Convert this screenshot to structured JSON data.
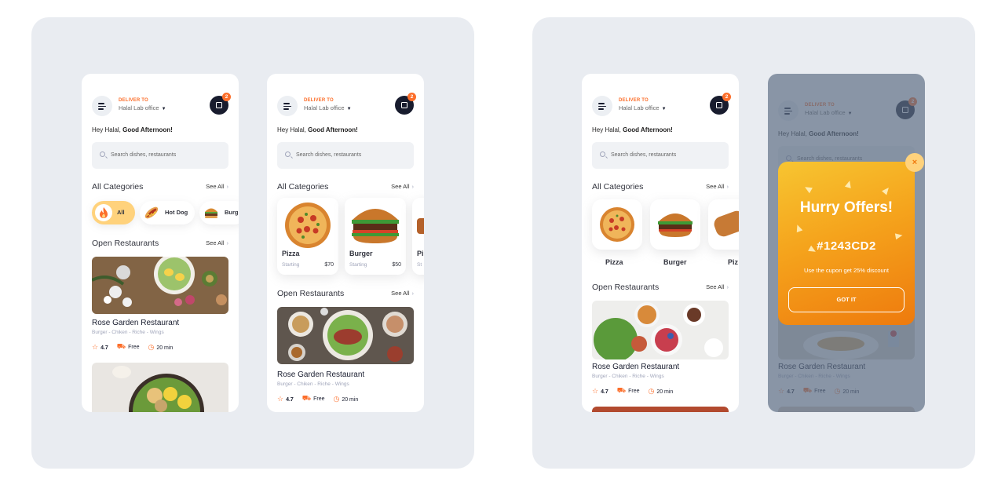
{
  "common": {
    "deliver_label": "DELIVER TO",
    "address": "Halal Lab office",
    "cart_count": "2",
    "greeting_prefix": "Hey Halal, ",
    "greeting_bold": "Good Afternoon!",
    "search_placeholder": "Search dishes, restaurants",
    "categories_title": "All Categories",
    "open_title": "Open Restaurants",
    "see_all": "See All",
    "restaurant_name": "Rose Garden Restaurant",
    "restaurant_tags": "Burger - Chiken - Riche - Wings",
    "rating": "4.7",
    "delivery": "Free",
    "time": "20 min"
  },
  "screen1": {
    "pills": [
      {
        "label": "All",
        "icon": "fire-icon"
      },
      {
        "label": "Hot Dog",
        "icon": "hot-dog-icon"
      },
      {
        "label": "Burg",
        "icon": "burger-icon"
      }
    ]
  },
  "screen2": {
    "cards": [
      {
        "name": "Pizza",
        "starting": "Starting",
        "price": "$70"
      },
      {
        "name": "Burger",
        "starting": "Starting",
        "price": "$50"
      },
      {
        "name": "Pi",
        "starting": "St",
        "price": ""
      }
    ]
  },
  "screen3": {
    "tiles": [
      "Pizza",
      "Burger",
      "Piz"
    ]
  },
  "screen4": {
    "offer_title": "Hurry Offers!",
    "offer_code": "#1243CD2",
    "offer_desc": "Use the cupon get 25% discount",
    "offer_button": "GOT IT",
    "close_icon": "×"
  },
  "colors": {
    "accent": "#fc6e2a",
    "panel_bg": "#e9ecf1",
    "category_active": "#ffd27c",
    "dark": "#181c2e",
    "offer_gradient_top": "#f7c531",
    "offer_gradient_bottom": "#ee7a0d"
  }
}
